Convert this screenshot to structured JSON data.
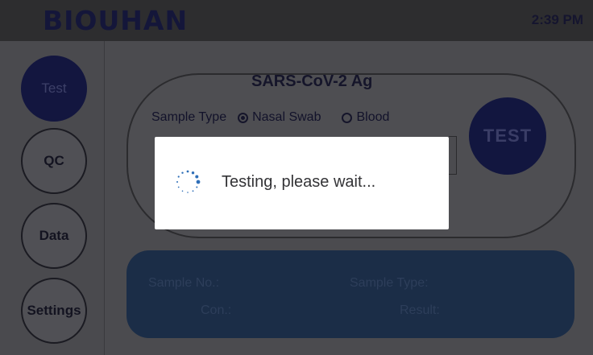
{
  "header": {
    "logo": "BIOUHAN",
    "time": "2:39 PM"
  },
  "sidebar": {
    "items": [
      {
        "label": "Test",
        "active": true
      },
      {
        "label": "QC",
        "active": false
      },
      {
        "label": "Data",
        "active": false
      },
      {
        "label": "Settings",
        "active": false
      }
    ]
  },
  "test_panel": {
    "assay_name": "SARS-CoV-2 Ag",
    "sample_type_label": "Sample Type",
    "sample_options": [
      {
        "label": "Nasal Swab",
        "selected": true
      },
      {
        "label": "Blood",
        "selected": false
      }
    ],
    "test_button_label": "TEST"
  },
  "results": {
    "sample_no_label": "Sample No.:",
    "sample_type_label": "Sample Type:",
    "con_label": "Con.:",
    "result_label": "Result:"
  },
  "modal": {
    "message": "Testing, please wait...",
    "spinner_icon": "loading-spinner-icon"
  },
  "colors": {
    "accent_navy": "#12163f",
    "result_panel": "#1b2d47",
    "overlay": "#4b4b4f"
  }
}
